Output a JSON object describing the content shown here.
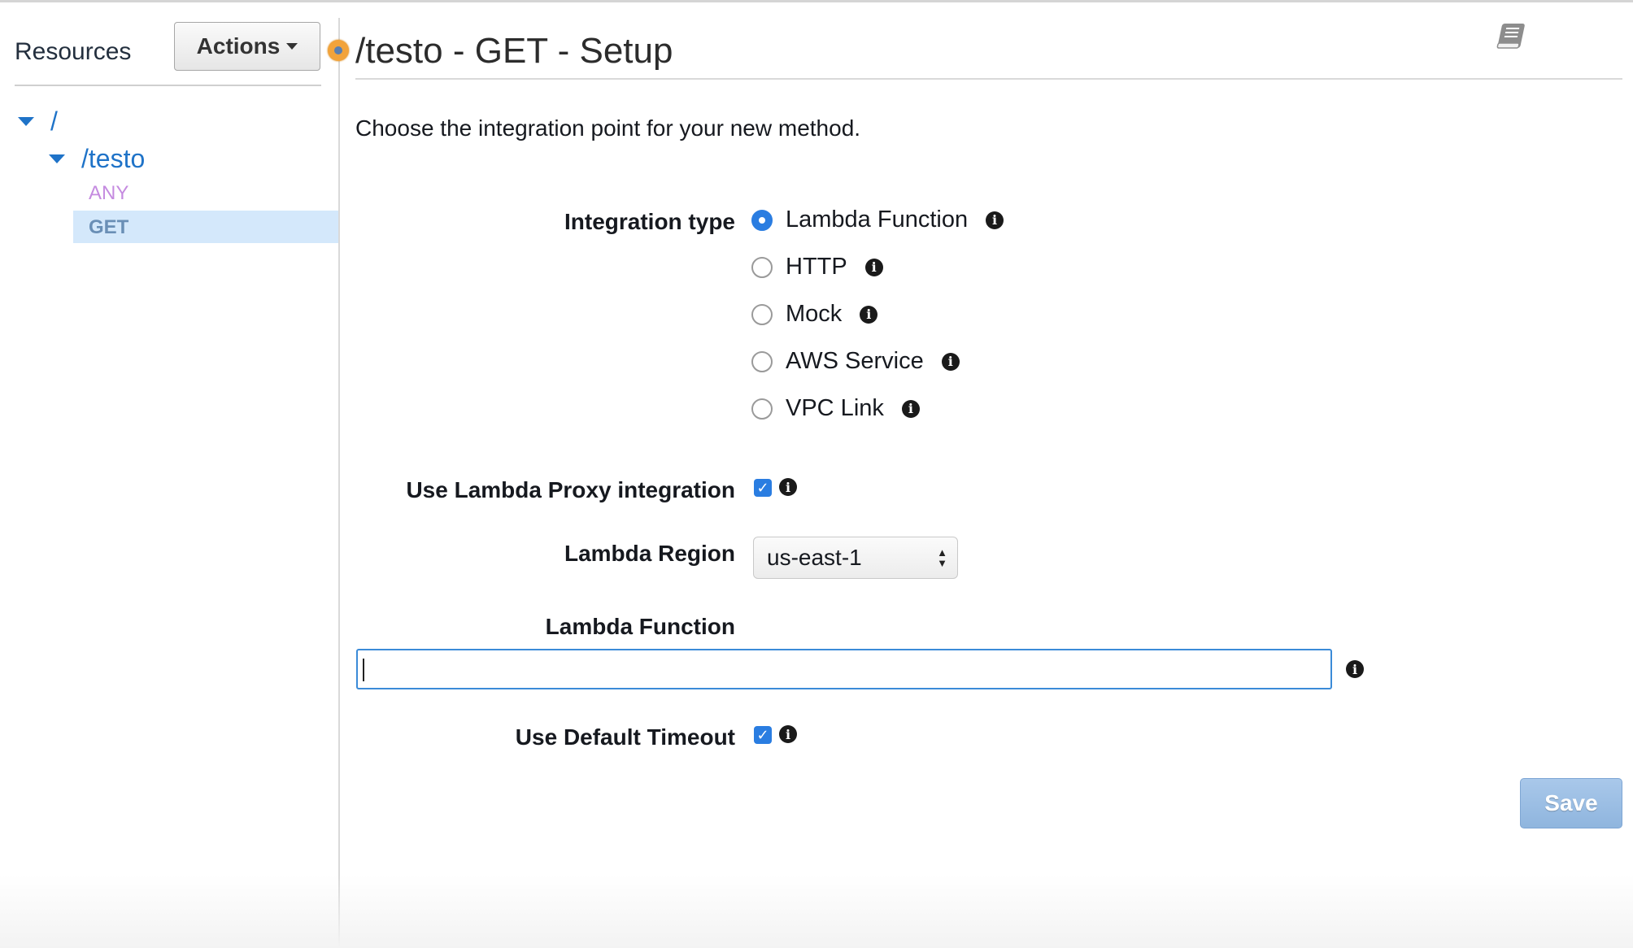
{
  "sidebar": {
    "title": "Resources",
    "actions_label": "Actions",
    "tree": {
      "root": "/",
      "child": "/testo",
      "methods": [
        "ANY",
        "GET"
      ]
    }
  },
  "main": {
    "title": "/testo - GET - Setup",
    "intro": "Choose the integration point for your new method.",
    "integration_type": {
      "label": "Integration type",
      "selected": "Lambda Function",
      "options": [
        "Lambda Function",
        "HTTP",
        "Mock",
        "AWS Service",
        "VPC Link"
      ]
    },
    "proxy": {
      "label": "Use Lambda Proxy integration",
      "checked": true
    },
    "region": {
      "label": "Lambda Region",
      "value": "us-east-1"
    },
    "function": {
      "label": "Lambda Function",
      "value": ""
    },
    "timeout": {
      "label": "Use Default Timeout",
      "checked": true
    },
    "save_label": "Save"
  },
  "colors": {
    "link": "#1f73c8",
    "any_method": "#c58be0",
    "selected_row": "#d4e8fb",
    "accent": "#2a7de1",
    "status_dot": "#f2a33a"
  },
  "icons": [
    "caret-down-icon",
    "tree-expand-icon",
    "book-icon",
    "info-icon",
    "checkmark-icon",
    "select-arrows-icon"
  ]
}
